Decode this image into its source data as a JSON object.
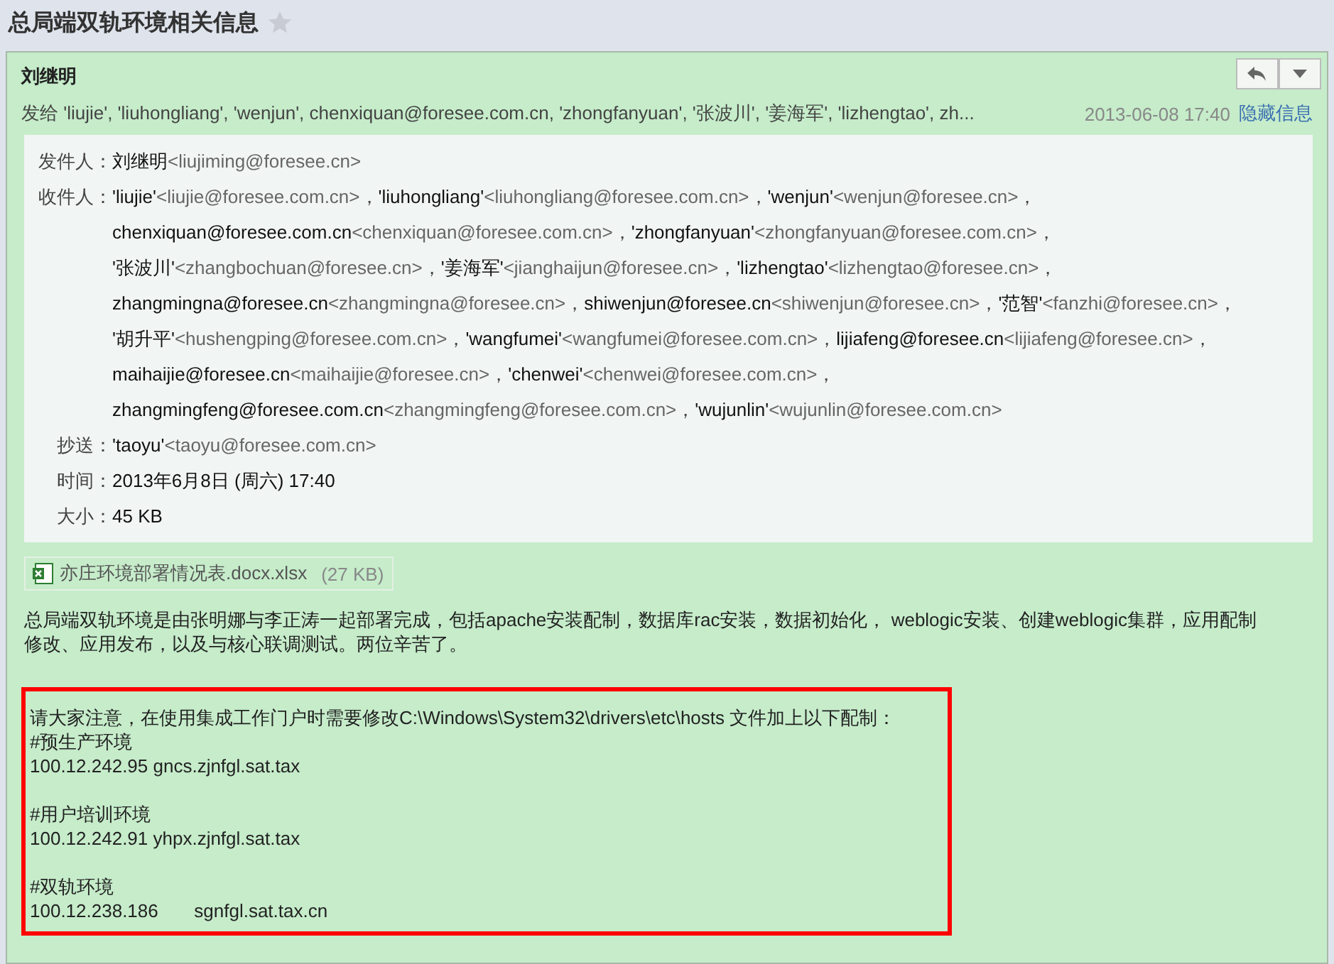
{
  "title": "总局端双轨环境相关信息",
  "starred": false,
  "header": {
    "sender": "刘继明",
    "summary": "发给 'liujie', 'liuhongliang', 'wenjun', chenxiquan@foresee.com.cn, 'zhongfanyuan', '张波川', '姜海军', 'lizhengtao', zh...",
    "date": "2013-06-08 17:40",
    "toggle": "隐藏信息"
  },
  "details": {
    "from": {
      "label": "发件人：",
      "name": "刘继明",
      "address": "<liujiming@foresee.cn>"
    },
    "to": {
      "label": "收件人：",
      "separator": "，",
      "lines": [
        [
          {
            "name": "'liujie'",
            "address": "<liujie@foresee.com.cn>"
          },
          {
            "name": "'liuhongliang'",
            "address": "<liuhongliang@foresee.com.cn>"
          },
          {
            "name": "'wenjun'",
            "address": "<wenjun@foresee.cn>"
          }
        ],
        [
          {
            "name": "chenxiquan@foresee.com.cn",
            "address": "<chenxiquan@foresee.com.cn>"
          },
          {
            "name": "'zhongfanyuan'",
            "address": "<zhongfanyuan@foresee.com.cn>"
          }
        ],
        [
          {
            "name": "'张波川'",
            "address": "<zhangbochuan@foresee.cn>"
          },
          {
            "name": "'姜海军'",
            "address": "<jianghaijun@foresee.cn>"
          },
          {
            "name": "'lizhengtao'",
            "address": "<lizhengtao@foresee.cn>"
          }
        ],
        [
          {
            "name": "zhangmingna@foresee.cn",
            "address": "<zhangmingna@foresee.cn>"
          },
          {
            "name": "shiwenjun@foresee.cn",
            "address": "<shiwenjun@foresee.cn>"
          },
          {
            "name": "'范智'",
            "address": "<fanzhi@foresee.cn>"
          }
        ],
        [
          {
            "name": "'胡升平'",
            "address": "<hushengping@foresee.com.cn>"
          },
          {
            "name": "'wangfumei'",
            "address": "<wangfumei@foresee.com.cn>"
          },
          {
            "name": "lijiafeng@foresee.cn",
            "address": "<lijiafeng@foresee.cn>"
          }
        ],
        [
          {
            "name": "maihaijie@foresee.cn",
            "address": "<maihaijie@foresee.cn>"
          },
          {
            "name": "'chenwei'",
            "address": "<chenwei@foresee.com.cn>"
          }
        ],
        [
          {
            "name": "zhangmingfeng@foresee.com.cn",
            "address": "<zhangmingfeng@foresee.com.cn>"
          },
          {
            "name": "'wujunlin'",
            "address": "<wujunlin@foresee.com.cn>"
          }
        ]
      ]
    },
    "cc": {
      "label": "抄送：",
      "name": "'taoyu'",
      "address": "<taoyu@foresee.com.cn>"
    },
    "time": {
      "label": "时间：",
      "value": "2013年6月8日 (周六) 17:40"
    },
    "size": {
      "label": "大小：",
      "value": "45 KB"
    }
  },
  "attachment": {
    "name": "亦庄环境部署情况表.docx.xlsx",
    "size": "(27 KB)"
  },
  "body": "总局端双轨环境是由张明娜与李正涛一起部署完成，包括apache安装配制，数据库rac安装，数据初始化，  weblogic安装、创建weblogic集群，应用配制修改、应用发布，以及与核心联调测试。两位辛苦了。",
  "notice": {
    "intro": "请大家注意，在使用集成工作门户时需要修改C:\\Windows\\System32\\drivers\\etc\\hosts 文件加上以下配制：",
    "blocks": [
      {
        "heading": "#预生产环境",
        "entry": "100.12.242.95 gncs.zjnfgl.sat.tax"
      },
      {
        "heading": "#用户培训环境",
        "entry": "100.12.242.91 yhpx.zjnfgl.sat.tax"
      },
      {
        "heading": "#双轨环境",
        "entry": "100.12.238.186       sgnfgl.sat.tax.cn"
      }
    ]
  }
}
